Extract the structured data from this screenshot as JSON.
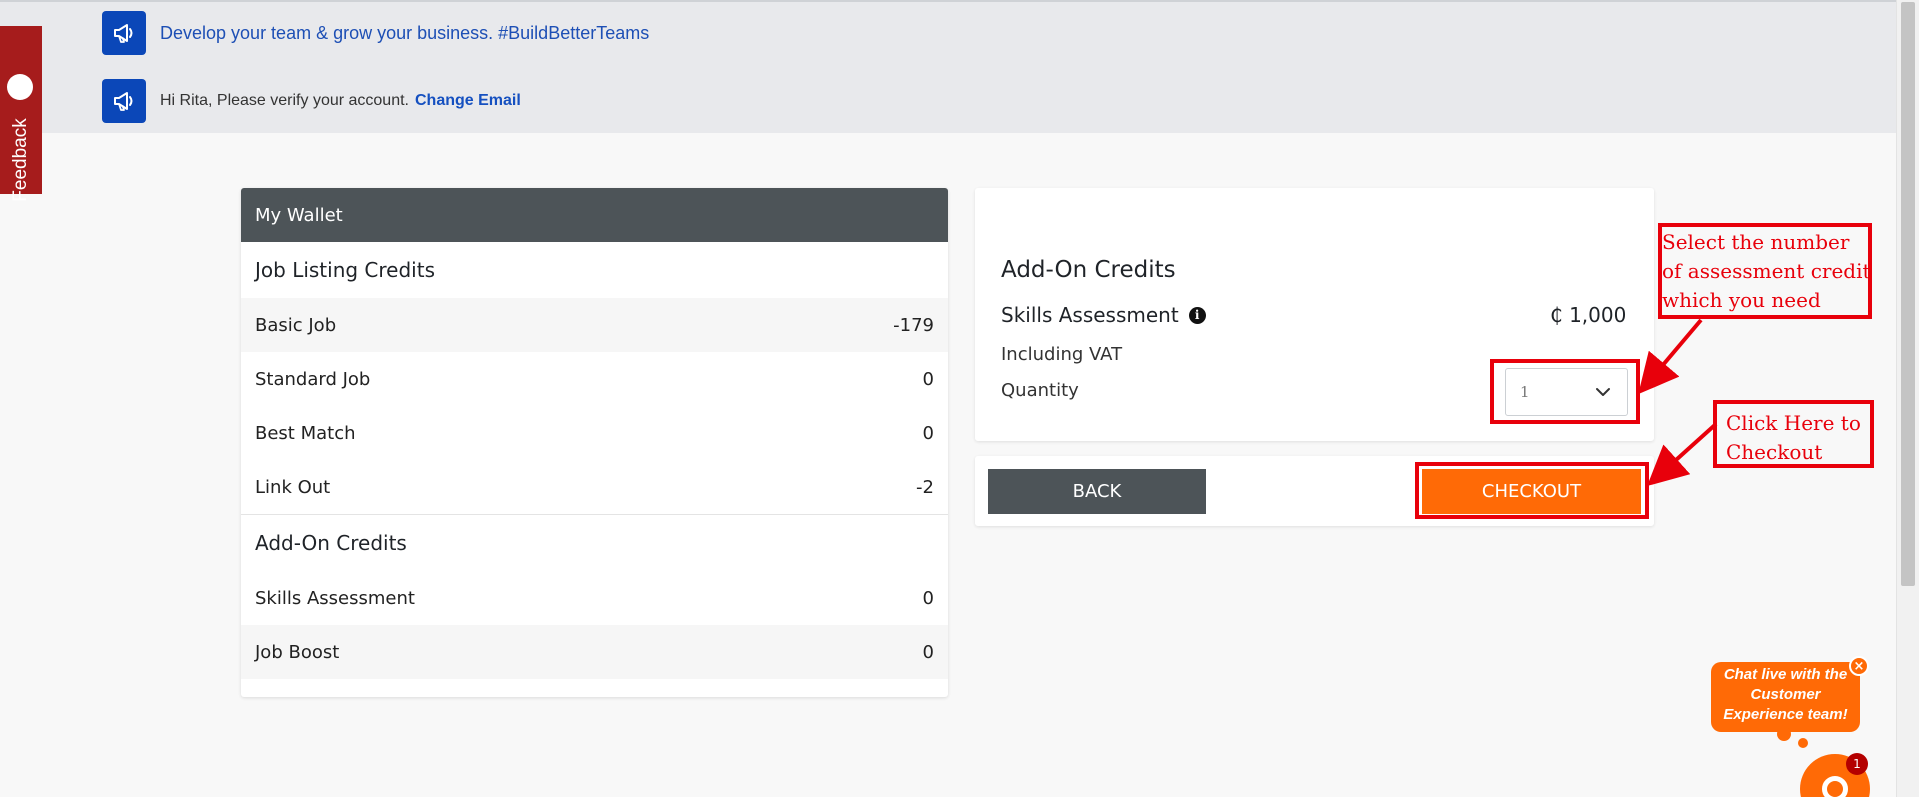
{
  "feedback": {
    "label": "Feedback"
  },
  "notices": [
    {
      "text": "Develop your team & grow your business. #BuildBetterTeams",
      "icon": "megaphone-icon"
    },
    {
      "text": "Hi Rita, Please verify your account.",
      "link": "Change Email",
      "icon": "megaphone-icon"
    }
  ],
  "wallet": {
    "title": "My Wallet",
    "job_listing": {
      "title": "Job Listing Credits",
      "rows": [
        {
          "label": "Basic Job",
          "value": "-179"
        },
        {
          "label": "Standard Job",
          "value": "0"
        },
        {
          "label": "Best Match",
          "value": "0"
        },
        {
          "label": "Link Out",
          "value": "-2"
        }
      ]
    },
    "addon": {
      "title": "Add-On Credits",
      "rows": [
        {
          "label": "Skills Assessment",
          "value": "0"
        },
        {
          "label": "Job Boost",
          "value": "0"
        }
      ]
    }
  },
  "purchase": {
    "title": "Add-On Credits",
    "item_name": "Skills Assessment",
    "info_icon": "i",
    "price": "₵ 1,000",
    "vat_note": "Including VAT",
    "quantity_label": "Quantity",
    "quantity_value": "1"
  },
  "buttons": {
    "back": "BACK",
    "checkout": "CHECKOUT"
  },
  "annotations": {
    "quantity_note": [
      "Select the number",
      "of assessment credit",
      "which you need"
    ],
    "checkout_note": [
      "Click Here to",
      "Checkout"
    ],
    "color": "#e8000b"
  },
  "chat": {
    "bubble": [
      "Chat live with the",
      "Customer",
      "Experience team!"
    ],
    "close": "×",
    "badge": "1",
    "color": "#ff6a06"
  },
  "colors": {
    "primary_blue": "#0b47b8",
    "dark_header": "#4d5458",
    "checkout_orange": "#ff6a06",
    "feedback_red": "#a61c1c"
  }
}
